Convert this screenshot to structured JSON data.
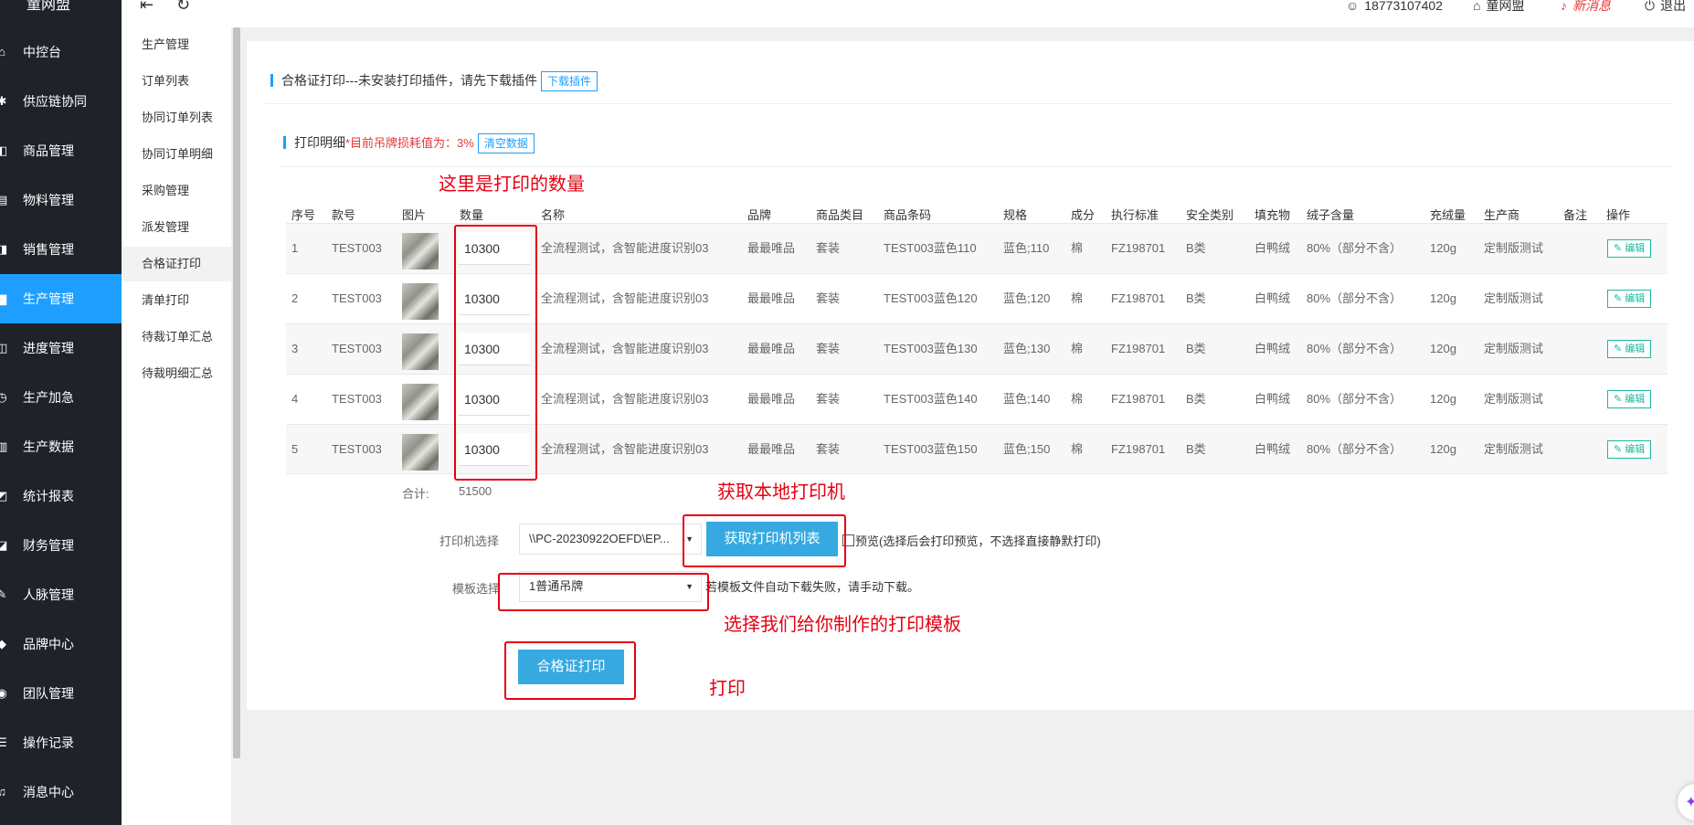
{
  "brand": "童网盟",
  "sidebar": [
    {
      "icon": "⌂",
      "label": "中控台"
    },
    {
      "icon": "✱",
      "label": "供应链协同"
    },
    {
      "icon": "◧",
      "label": "商品管理"
    },
    {
      "icon": "▤",
      "label": "物料管理"
    },
    {
      "icon": "◨",
      "label": "销售管理"
    },
    {
      "icon": "▆",
      "label": "生产管理"
    },
    {
      "icon": "◫",
      "label": "进度管理"
    },
    {
      "icon": "◷",
      "label": "生产加急"
    },
    {
      "icon": "▥",
      "label": "生产数据"
    },
    {
      "icon": "◩",
      "label": "统计报表"
    },
    {
      "icon": "◪",
      "label": "财务管理"
    },
    {
      "icon": "✎",
      "label": "人脉管理"
    },
    {
      "icon": "◆",
      "label": "品牌中心"
    },
    {
      "icon": "◉",
      "label": "团队管理"
    },
    {
      "icon": "☰",
      "label": "操作记录"
    },
    {
      "icon": "♫",
      "label": "消息中心"
    }
  ],
  "topbar": {
    "collapse_icon": "⇤",
    "refresh_icon": "↻",
    "user_phone": "18773107402",
    "shop": "童网盟",
    "new_msg": "新消息",
    "logout": "退出"
  },
  "subnav": [
    "生产管理",
    "订单列表",
    "协同订单列表",
    "协同订单明细",
    "采购管理",
    "派发管理",
    "合格证打印",
    "清单打印",
    "待裁订单汇总",
    "待裁明细汇总"
  ],
  "page": {
    "title": "合格证打印---未安装打印插件，请先下载插件",
    "download_btn": "下载插件",
    "print_detail": "打印明细",
    "loss_note": "*目前吊牌损耗值为：3%",
    "clear_btn": "清空数据"
  },
  "table": {
    "headers": [
      "序号",
      "款号",
      "图片",
      "数量",
      "名称",
      "品牌",
      "商品类目",
      "商品条码",
      "规格",
      "成分",
      "执行标准",
      "安全类别",
      "填充物",
      "绒子含量",
      "充绒量",
      "生产商",
      "备注",
      "操作"
    ],
    "rows": [
      {
        "no": "1",
        "style": "TEST003",
        "qty": "10300",
        "name": "全流程测试，含智能进度识别03",
        "brand": "最最唯品",
        "category": "套装",
        "barcode": "TEST003蓝色110",
        "spec": "蓝色;110",
        "comp": "棉",
        "std": "FZ198701",
        "safety": "B类",
        "filler": "白鸭绒",
        "down": "80%（部分不含）",
        "fill": "120g",
        "maker": "定制版测试",
        "remark": "",
        "edit": "✎ 编辑"
      },
      {
        "no": "2",
        "style": "TEST003",
        "qty": "10300",
        "name": "全流程测试，含智能进度识别03",
        "brand": "最最唯品",
        "category": "套装",
        "barcode": "TEST003蓝色120",
        "spec": "蓝色;120",
        "comp": "棉",
        "std": "FZ198701",
        "safety": "B类",
        "filler": "白鸭绒",
        "down": "80%（部分不含）",
        "fill": "120g",
        "maker": "定制版测试",
        "remark": "",
        "edit": "✎ 编辑"
      },
      {
        "no": "3",
        "style": "TEST003",
        "qty": "10300",
        "name": "全流程测试，含智能进度识别03",
        "brand": "最最唯品",
        "category": "套装",
        "barcode": "TEST003蓝色130",
        "spec": "蓝色;130",
        "comp": "棉",
        "std": "FZ198701",
        "safety": "B类",
        "filler": "白鸭绒",
        "down": "80%（部分不含）",
        "fill": "120g",
        "maker": "定制版测试",
        "remark": "",
        "edit": "✎ 编辑"
      },
      {
        "no": "4",
        "style": "TEST003",
        "qty": "10300",
        "name": "全流程测试，含智能进度识别03",
        "brand": "最最唯品",
        "category": "套装",
        "barcode": "TEST003蓝色140",
        "spec": "蓝色;140",
        "comp": "棉",
        "std": "FZ198701",
        "safety": "B类",
        "filler": "白鸭绒",
        "down": "80%（部分不含）",
        "fill": "120g",
        "maker": "定制版测试",
        "remark": "",
        "edit": "✎ 编辑"
      },
      {
        "no": "5",
        "style": "TEST003",
        "qty": "10300",
        "name": "全流程测试，含智能进度识别03",
        "brand": "最最唯品",
        "category": "套装",
        "barcode": "TEST003蓝色150",
        "spec": "蓝色;150",
        "comp": "棉",
        "std": "FZ198701",
        "safety": "B类",
        "filler": "白鸭绒",
        "down": "80%（部分不含）",
        "fill": "120g",
        "maker": "定制版测试",
        "remark": "",
        "edit": "✎ 编辑"
      }
    ],
    "total_label": "合计:",
    "total_value": "51500"
  },
  "form": {
    "printer_label": "打印机选择",
    "printer_value": "\\\\PC-20230922OEFD\\EP...",
    "get_printers_btn": "获取打印机列表",
    "preview_text": "预览(选择后会打印预览，不选择直接静默打印)",
    "template_label": "模板选择",
    "template_value": "1普通吊牌",
    "template_note": "若模板文件自动下载失败，请手动下载。",
    "print_btn": "合格证打印"
  },
  "annotations": {
    "qty": "这里是打印的数量",
    "printer": "获取本地打印机",
    "template": "选择我们给你制作的打印模板",
    "print": "打印"
  }
}
